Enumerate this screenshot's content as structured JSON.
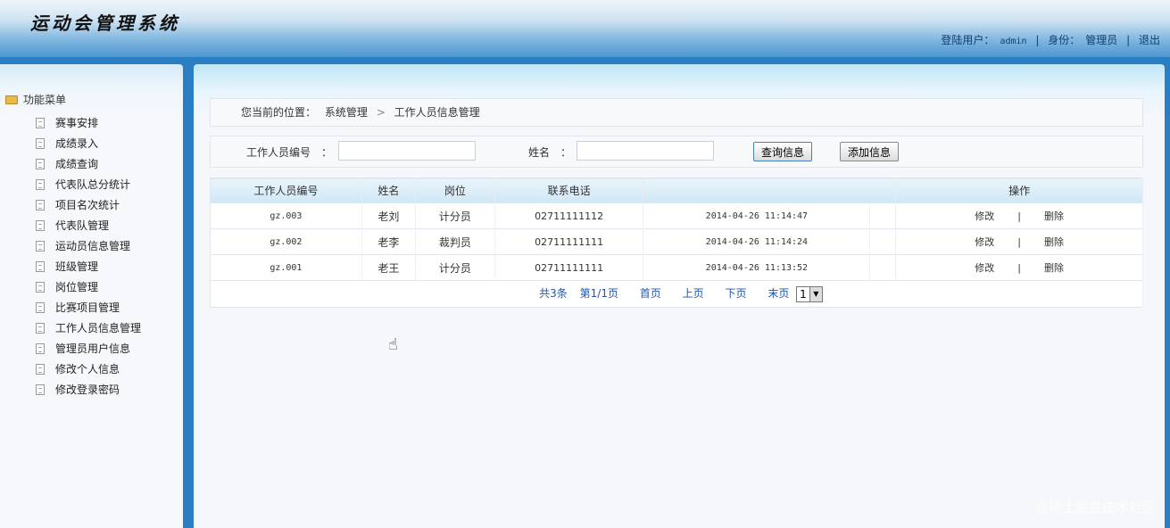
{
  "app": {
    "title": "运动会管理系统"
  },
  "userbar": {
    "login_label": "登陆用户：",
    "user": "admin",
    "sep": "|",
    "role_label": "身份：",
    "role": "管理员",
    "logout": "退出"
  },
  "sidebar": {
    "title": "功能菜单",
    "items": [
      {
        "label": "赛事安排"
      },
      {
        "label": "成绩录入"
      },
      {
        "label": "成绩查询"
      },
      {
        "label": "代表队总分统计"
      },
      {
        "label": "项目名次统计"
      },
      {
        "label": "代表队管理"
      },
      {
        "label": "运动员信息管理"
      },
      {
        "label": "班级管理"
      },
      {
        "label": "岗位管理"
      },
      {
        "label": "比赛项目管理"
      },
      {
        "label": "工作人员信息管理"
      },
      {
        "label": "管理员用户信息"
      },
      {
        "label": "修改个人信息"
      },
      {
        "label": "修改登录密码"
      }
    ]
  },
  "breadcrumb": {
    "label": "您当前的位置：",
    "section": "系统管理",
    "sep": ">",
    "page": "工作人员信息管理"
  },
  "search": {
    "id_label": "工作人员编号　：",
    "id_value": "",
    "name_label": "姓名　：",
    "name_value": "",
    "query_button": "查询信息",
    "add_button": "添加信息"
  },
  "table": {
    "headers": [
      "工作人员编号",
      "姓名",
      "岗位",
      "联系电话",
      "",
      "操作"
    ],
    "rows": [
      {
        "id": "gz.003",
        "name": "老刘",
        "post": "计分员",
        "phone": "02711111112",
        "time": "2014-04-26 11:14:47"
      },
      {
        "id": "gz.002",
        "name": "老李",
        "post": "裁判员",
        "phone": "02711111111",
        "time": "2014-04-26 11:14:24"
      },
      {
        "id": "gz.001",
        "name": "老王",
        "post": "计分员",
        "phone": "02711111111",
        "time": "2014-04-26 11:13:52"
      }
    ],
    "edit": "修改",
    "op_sep": "|",
    "delete": "删除"
  },
  "pager": {
    "total": "共3条",
    "page": "第1/1页",
    "first": "首页",
    "prev": "上页",
    "next": "下页",
    "last": "末页",
    "selected": "1"
  },
  "watermark": "@稀土掘金技术社区"
}
